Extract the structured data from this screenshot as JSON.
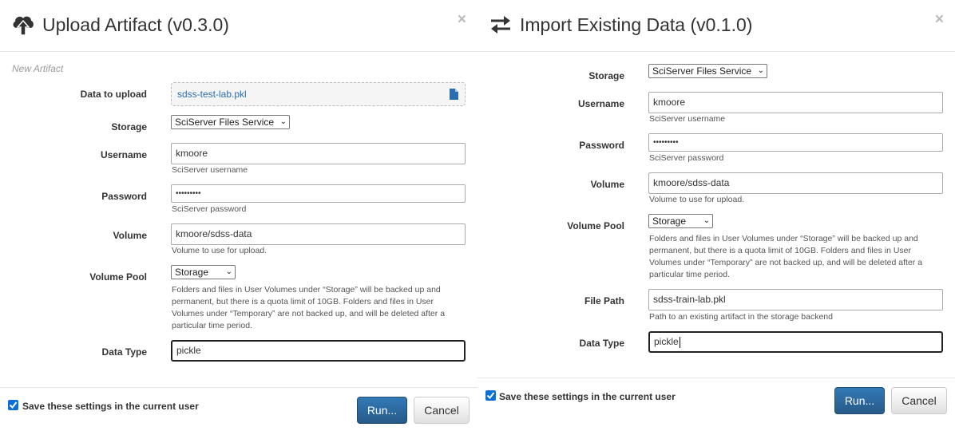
{
  "left": {
    "title": "Upload Artifact (v0.3.0)",
    "close": "×",
    "subtitle": "New Artifact",
    "data_to_upload_label": "Data to upload",
    "file_name": "sdss-test-lab.pkl",
    "storage_label": "Storage",
    "storage_value": "SciServer Files Service",
    "username_label": "Username",
    "username_value": "kmoore",
    "username_help": "SciServer username",
    "password_label": "Password",
    "password_value": "•••••••••",
    "password_help": "SciServer password",
    "volume_label": "Volume",
    "volume_value": "kmoore/sdss-data",
    "volume_help": "Volume to use for upload.",
    "volume_pool_label": "Volume Pool",
    "volume_pool_value": "Storage",
    "volume_pool_help_1": "Folders and files in User Volumes under “Storage” will be backed up and",
    "volume_pool_help_2": "permanent, but there is a quota limit of 10GB. Folders and files in User",
    "volume_pool_help_3": "Volumes under “Temporary” are not backed up, and will be deleted after a",
    "volume_pool_help_4": "particular time period.",
    "data_type_label": "Data Type",
    "data_type_value": "pickle",
    "save_settings": "Save these settings in the current user",
    "run": "Run...",
    "cancel": "Cancel"
  },
  "right": {
    "title": "Import Existing Data (v0.1.0)",
    "close": "×",
    "storage_label": "Storage",
    "storage_value": "SciServer Files Service",
    "username_label": "Username",
    "username_value": "kmoore",
    "username_help": "SciServer username",
    "password_label": "Password",
    "password_value": "•••••••••",
    "password_help": "SciServer password",
    "volume_label": "Volume",
    "volume_value": "kmoore/sdss-data",
    "volume_help": "Volume to use for upload.",
    "volume_pool_label": "Volume Pool",
    "volume_pool_value": "Storage",
    "volume_pool_help_1": "Folders and files in User Volumes under “Storage” will be backed up and",
    "volume_pool_help_2": "permanent, but there is a quota limit of 10GB. Folders and files in User",
    "volume_pool_help_3": "Volumes under “Temporary” are not backed up, and will be deleted after a",
    "volume_pool_help_4": "particular time period.",
    "file_path_label": "File Path",
    "file_path_value": "sdss-train-lab.pkl",
    "file_path_help": "Path to an existing artifact in the storage backend",
    "data_type_label": "Data Type",
    "data_type_value": "pickle",
    "save_settings": "Save these settings in the current user",
    "run": "Run...",
    "cancel": "Cancel"
  },
  "icons": {
    "left_header": "cloud-upload-icon",
    "right_header": "transfer-arrows-icon",
    "file": "file-icon",
    "checkbox": "checkbox-checked-icon"
  },
  "colors": {
    "primary_button": "#2f6fad",
    "link": "#2a6db0",
    "checkbox": "#0b6fd8"
  }
}
